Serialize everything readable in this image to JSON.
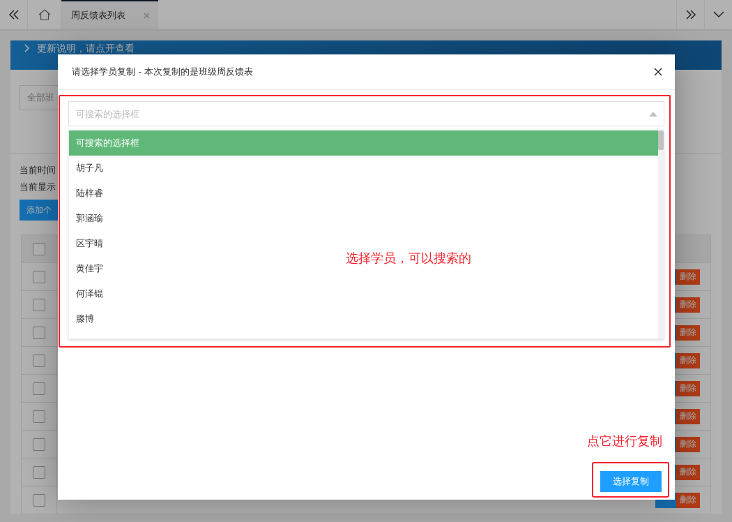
{
  "tabbar": {
    "tabs": [
      {
        "label": "周反馈表列表",
        "selected": true
      }
    ]
  },
  "background": {
    "notice": "更新说明，请点开查看",
    "class_filter": "全部班",
    "lines": [
      "当前时间",
      "当前显示"
    ],
    "add_button": "添加个",
    "table": {
      "header": {
        "checked": false
      },
      "rows": [
        {
          "checked": false,
          "delete": "删除"
        },
        {
          "checked": false,
          "delete": "删除"
        },
        {
          "checked": false,
          "delete": "删除"
        },
        {
          "checked": false,
          "delete": "删除"
        },
        {
          "checked": false,
          "delete": "删除"
        },
        {
          "checked": false,
          "delete": "删除"
        },
        {
          "checked": false,
          "delete": "删除"
        },
        {
          "checked": false,
          "delete": "删除"
        },
        {
          "checked": false,
          "delete": "删除"
        }
      ]
    }
  },
  "dialog": {
    "title": "请选择学员复制 - 本次复制的是班级周反馈表",
    "select": {
      "placeholder": "可搜索的选择框",
      "expanded": true
    },
    "options": [
      {
        "label": "可搜索的选择框",
        "selected": true
      },
      {
        "label": "胡子凡",
        "selected": false
      },
      {
        "label": "陆梓睿",
        "selected": false
      },
      {
        "label": "郭涵瑜",
        "selected": false
      },
      {
        "label": "区宇晴",
        "selected": false
      },
      {
        "label": "黄佳宇",
        "selected": false
      },
      {
        "label": "何泽锟",
        "selected": false
      },
      {
        "label": "滕博",
        "selected": false
      }
    ],
    "confirm_button": "选择复制"
  },
  "annotations": {
    "select_note": "选择学员，可以搜索的",
    "button_note": "点它进行复制"
  }
}
